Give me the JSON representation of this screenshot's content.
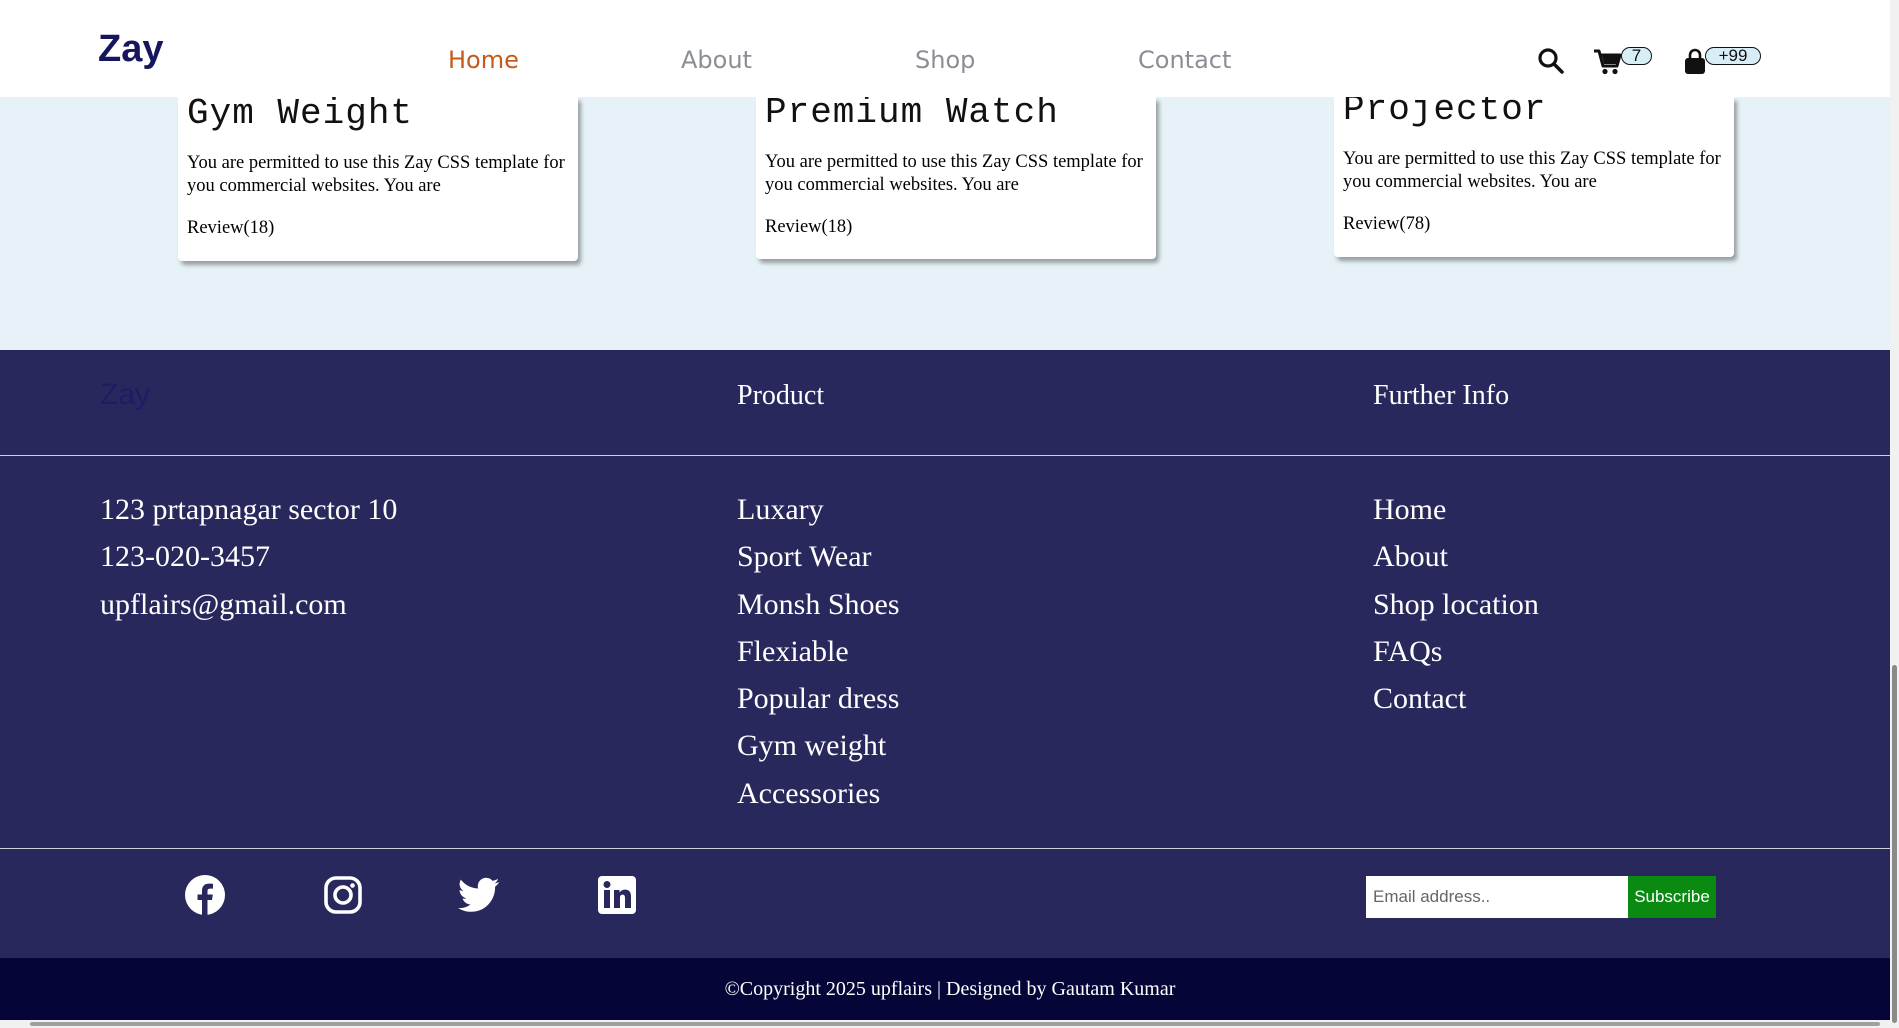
{
  "header": {
    "logo": "Zay",
    "nav": [
      "Home",
      "About",
      "Shop",
      "Contact"
    ],
    "active_nav": "Home",
    "cart_count": "7",
    "bag_count": "+99"
  },
  "products": [
    {
      "title": "Gym Weight",
      "desc": "You are permitted to use this Zay CSS template for you commercial websites. You are",
      "review": "Review(18)"
    },
    {
      "title": "Premium Watch",
      "desc": "You are permitted to use this Zay CSS template for you commercial websites. You are",
      "review": "Review(18)"
    },
    {
      "title": "Projector",
      "desc": "You are permitted to use this Zay CSS template for you commercial websites. You are",
      "review": "Review(78)"
    }
  ],
  "footer": {
    "brand": "Zay",
    "product_heading": "Product",
    "info_heading": "Further Info",
    "contact": {
      "address": "123 prtapnagar sector 10",
      "phone": "123-020-3457",
      "email": "upflairs@gmail.com"
    },
    "product_links": [
      "Luxary",
      "Sport Wear",
      "Monsh Shoes",
      "Flexiable",
      "Popular dress",
      "Gym weight",
      "Accessories"
    ],
    "info_links": [
      "Home",
      "About",
      "Shop location",
      "FAQs",
      "Contact"
    ],
    "social_icons": [
      "facebook-icon",
      "instagram-icon",
      "twitter-icon",
      "linkedin-icon"
    ],
    "newsletter": {
      "placeholder": "Email address..",
      "button": "Subscribe"
    },
    "copyright": "©Copyright 2025 upflairs | Designed by Gautam Kumar"
  },
  "colors": {
    "brand_navy": "#15165e",
    "footer_bg": "#29285d",
    "copyright_bg": "#050538",
    "active_nav": "#c65a1a",
    "subscribe_bg": "#0b8a12",
    "section_bg": "#e6f2f7"
  }
}
